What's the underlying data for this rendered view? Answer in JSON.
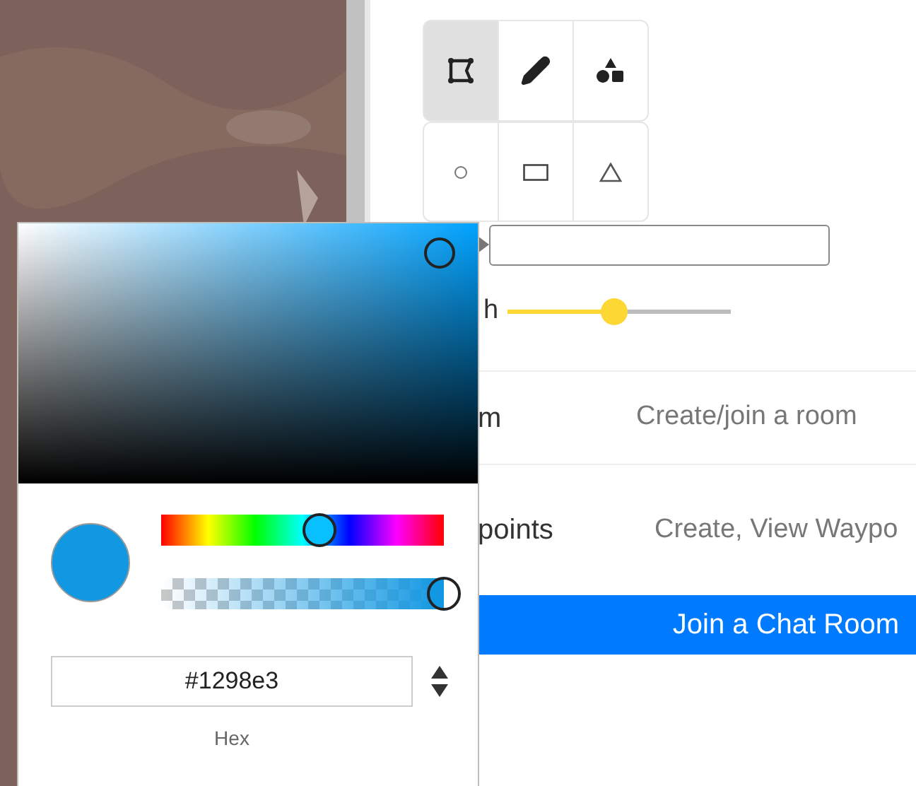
{
  "tools": [
    {
      "kind": "polygon",
      "selected": true
    },
    {
      "kind": "pencil",
      "selected": false
    },
    {
      "kind": "shapes",
      "selected": false
    }
  ],
  "shapes": [
    {
      "kind": "circle",
      "selected": false
    },
    {
      "kind": "rectangle",
      "selected": false
    },
    {
      "kind": "triangle",
      "selected": false
    }
  ],
  "width": {
    "label": "h",
    "level": 0.48
  },
  "rows": [
    {
      "label": "m",
      "description": "Create/join a room"
    },
    {
      "label": "points",
      "description": "Create, View Waypo"
    }
  ],
  "join_button": "Join a Chat Room",
  "color_picker": {
    "hue": {
      "level": 0.56
    },
    "alpha": {
      "level": 1
    },
    "hex": "#1298e3",
    "format_label": "Hex"
  }
}
